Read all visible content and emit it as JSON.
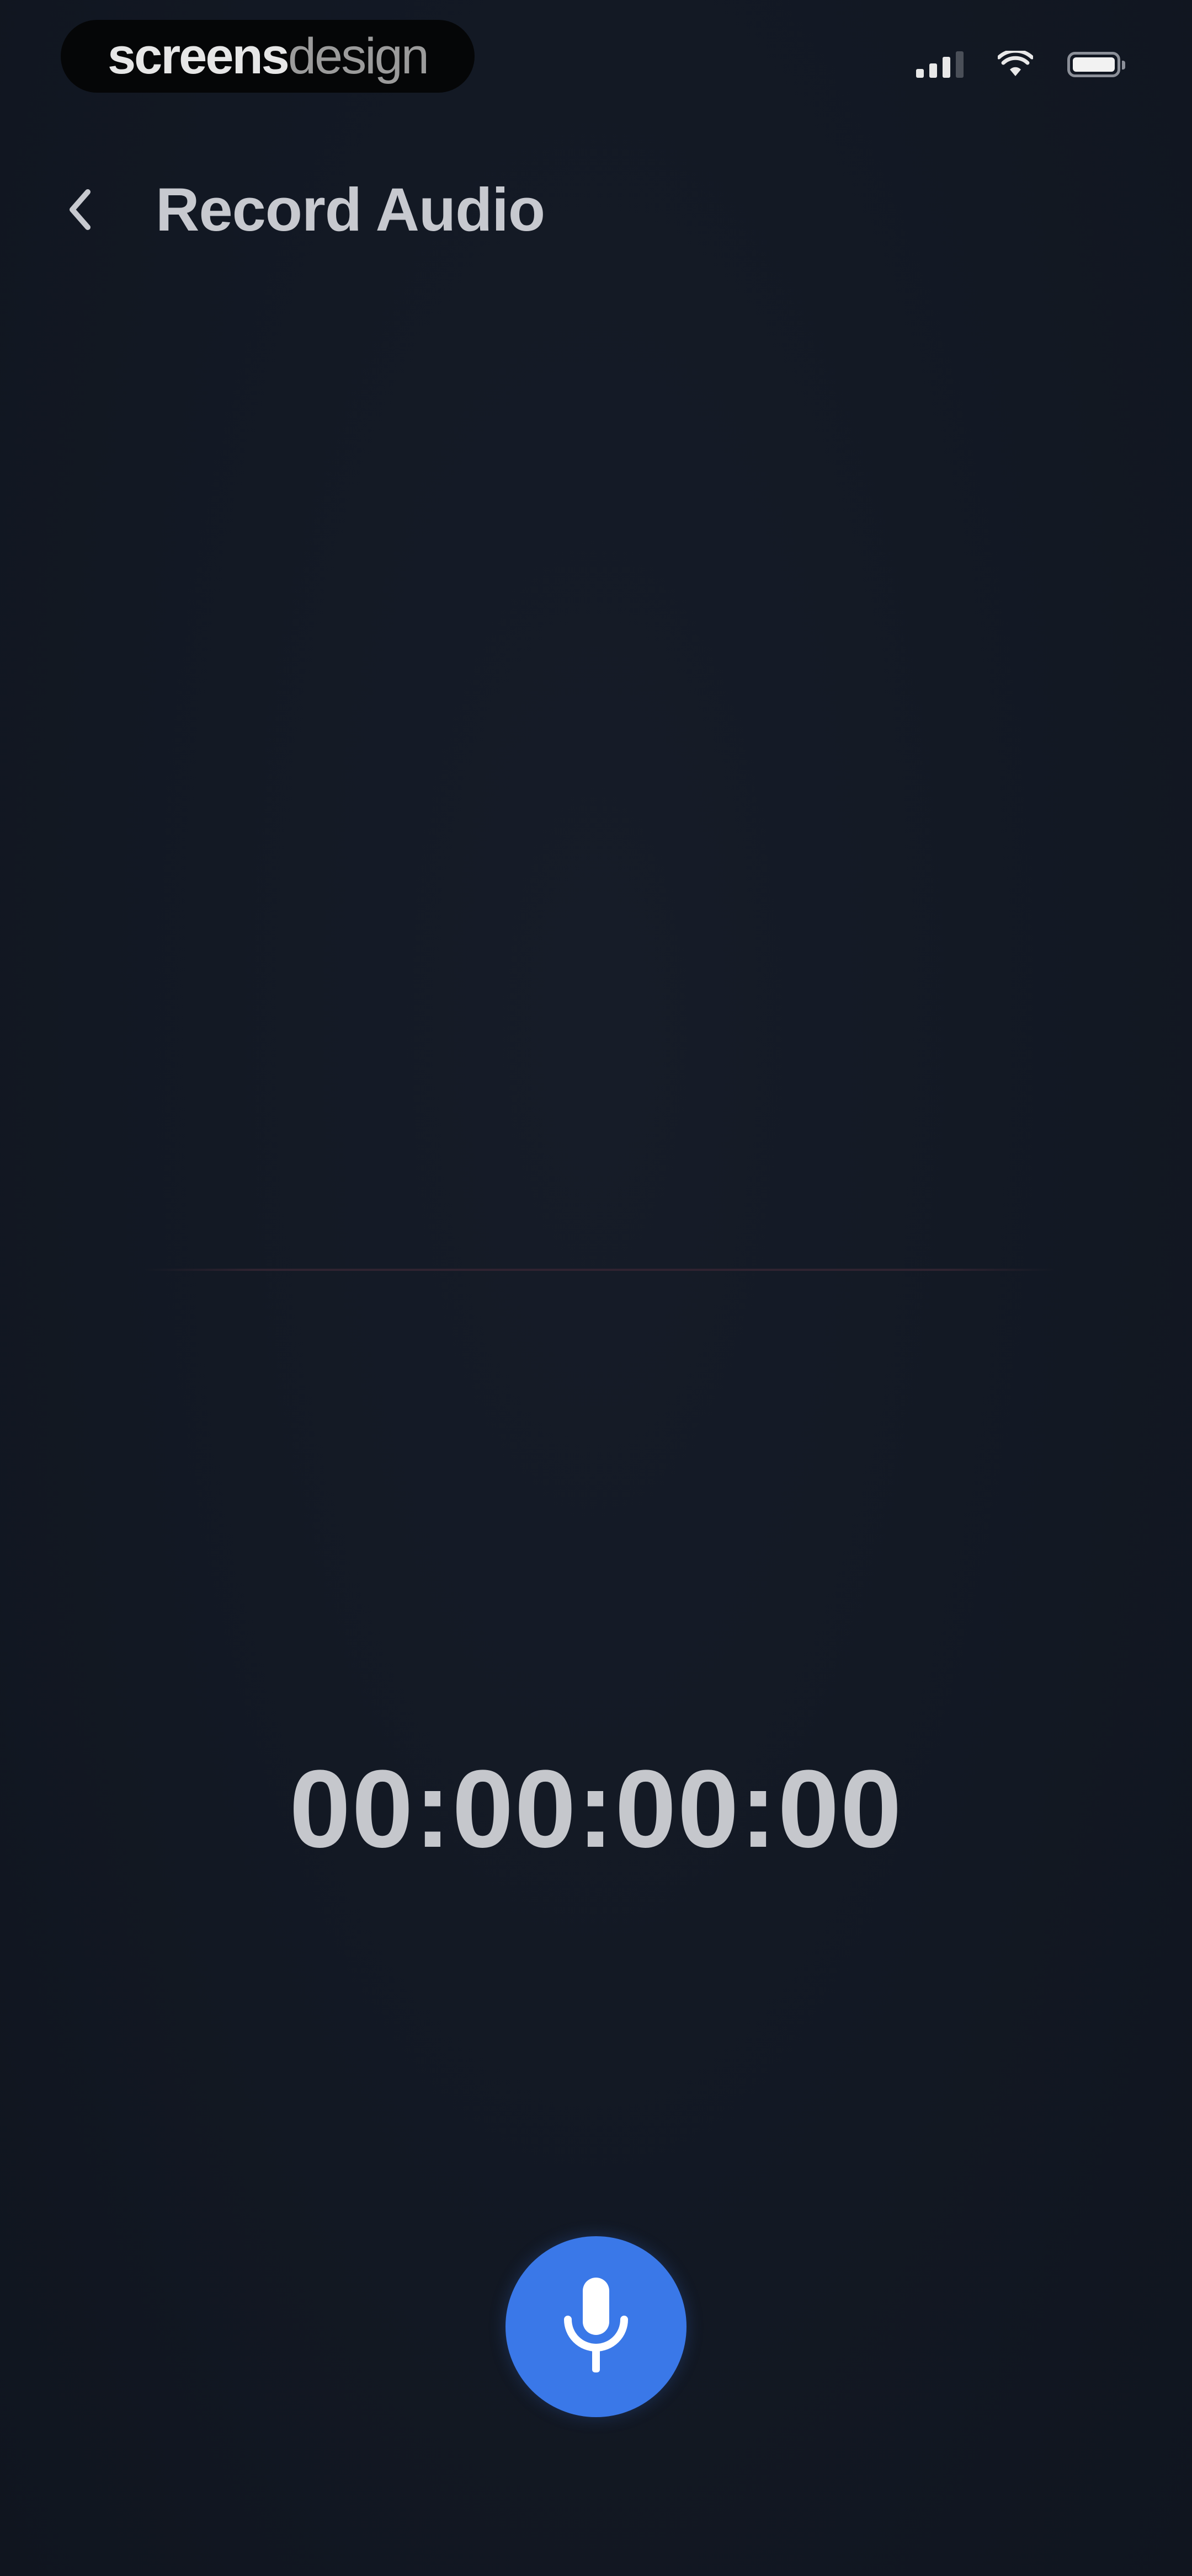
{
  "status_bar": {
    "watermark_strong": "screens",
    "watermark_light": "design",
    "signal_icon": "cellular-signal-icon",
    "wifi_icon": "wifi-icon",
    "battery_icon": "battery-icon"
  },
  "header": {
    "back_icon": "chevron-left-icon",
    "title": "Record Audio"
  },
  "recorder": {
    "timer": "00:00:00:00",
    "record_icon": "microphone-icon",
    "accent_color": "#3a78e8"
  },
  "colors": {
    "background": "#131924",
    "text": "#c7c9cf"
  }
}
